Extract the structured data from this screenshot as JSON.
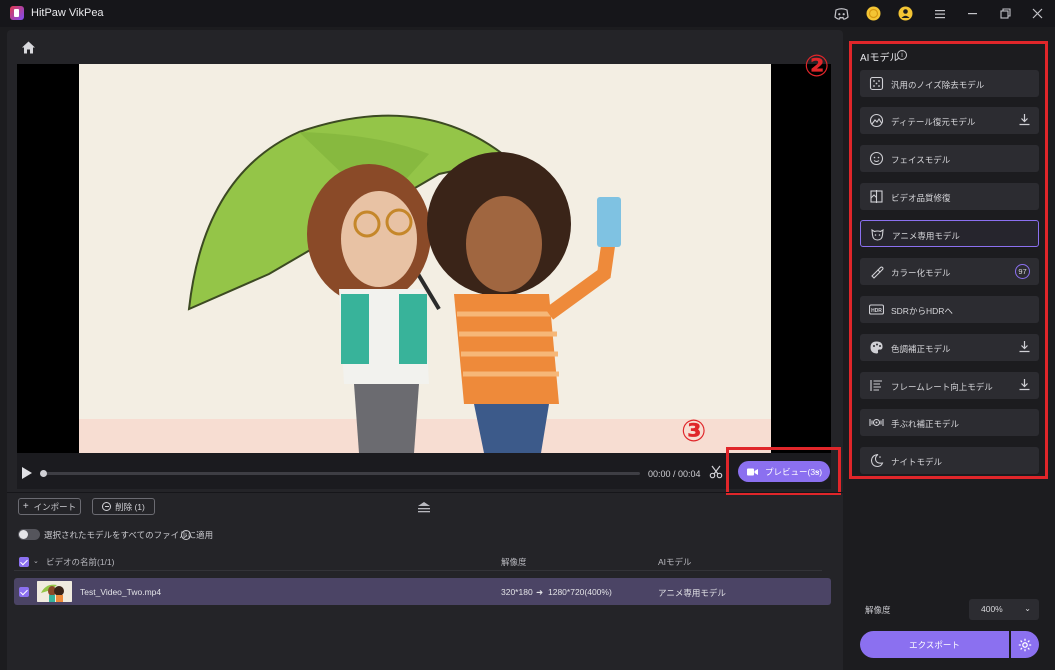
{
  "app": {
    "title": "HitPaw VikPea"
  },
  "titlebar_icons": [
    "discord-icon",
    "coin-icon",
    "account-icon",
    "menu-icon",
    "minimize-icon",
    "restore-icon",
    "close-icon"
  ],
  "player": {
    "timecode": "00:00 / 00:04",
    "preview_label": "プレビュー(3s)",
    "progress": 0
  },
  "annotations": {
    "circle_2": "②",
    "circle_3": "③"
  },
  "toolbar": {
    "import_label": "インポート",
    "delete_label": "削除 (1)"
  },
  "apply_all": {
    "label": "選択されたモデルをすべてのファイルに適用",
    "enabled": false,
    "info": "i"
  },
  "table": {
    "headers": {
      "name": "ビデオの名前(1/1)",
      "resolution": "解像度",
      "model": "AIモデル"
    },
    "rows": [
      {
        "file": "Test_Video_Two.mp4",
        "res_from": "320*180",
        "res_to": "1280*720(400%)",
        "model": "アニメ専用モデル",
        "checked": true
      }
    ]
  },
  "sidebar": {
    "title": "AIモデル",
    "info": "i",
    "models": [
      {
        "label": "汎用のノイズ除去モデル",
        "icon": "denoise-icon",
        "download": false,
        "selected": false
      },
      {
        "label": "ディテール復元モデル",
        "icon": "detail-restore-icon",
        "download": true,
        "selected": false
      },
      {
        "label": "フェイスモデル",
        "icon": "face-icon",
        "download": false,
        "selected": false
      },
      {
        "label": "ビデオ品質修復",
        "icon": "quality-repair-icon",
        "download": false,
        "selected": false
      },
      {
        "label": "アニメ専用モデル",
        "icon": "anime-icon",
        "download": false,
        "selected": true
      },
      {
        "label": "カラー化モデル",
        "icon": "colorize-icon",
        "download": false,
        "selected": false,
        "badge": "97"
      },
      {
        "label": "SDRからHDRへ",
        "icon": "hdr-icon",
        "download": false,
        "selected": false
      },
      {
        "label": "色調補正モデル",
        "icon": "palette-icon",
        "download": true,
        "selected": false
      },
      {
        "label": "フレームレート向上モデル",
        "icon": "frame-rate-icon",
        "download": true,
        "selected": false
      },
      {
        "label": "手ぶれ補正モデル",
        "icon": "stabilize-icon",
        "download": false,
        "selected": false
      },
      {
        "label": "ナイトモデル",
        "icon": "night-icon",
        "download": false,
        "selected": false
      }
    ],
    "resolution_label": "解像度",
    "resolution_value": "400%",
    "export_label": "エクスポート"
  },
  "colors": {
    "accent": "#8b70f0",
    "highlight": "#e0262a",
    "row_selected": "#4b4465"
  }
}
